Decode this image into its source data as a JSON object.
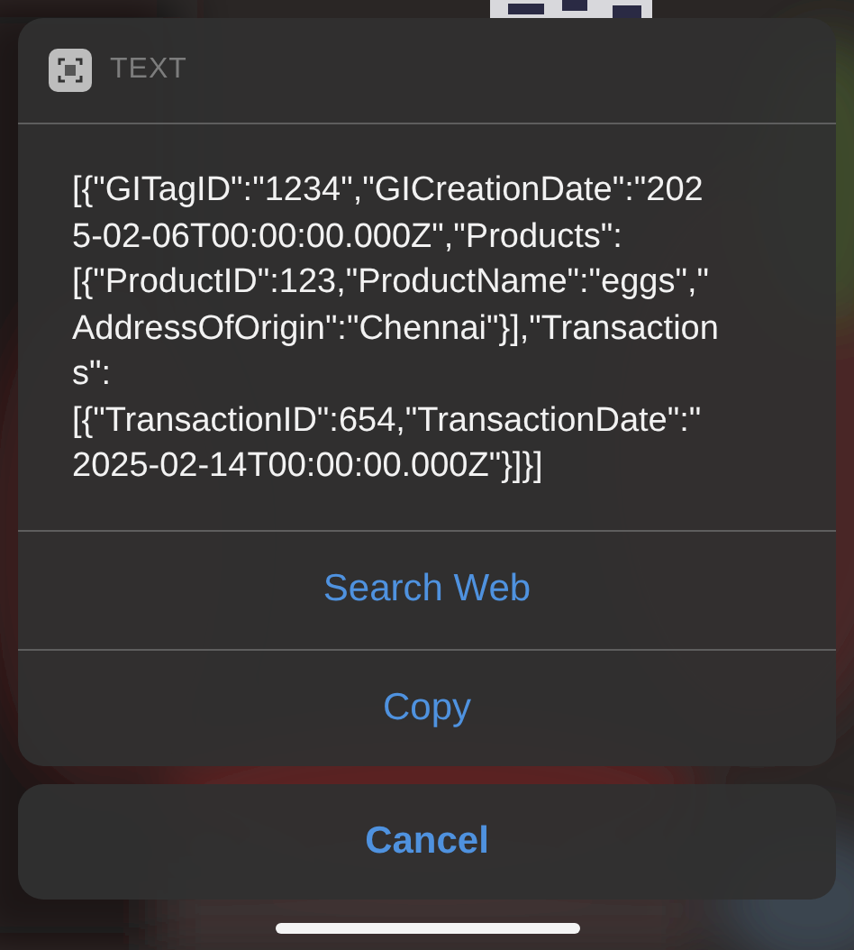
{
  "sheet": {
    "header": {
      "label": "TEXT"
    },
    "content_lines": [
      "[{\"GITagID\":\"1234\",\"GICreationDate\":\"202",
      "5-02-06T00:00:00.000Z\",\"Products\":",
      "[{\"ProductID\":123,\"ProductName\":\"eggs\",\"",
      "AddressOfOrigin\":\"Chennai\"}],\"Transaction",
      "s\":",
      "[{\"TransactionID\":654,\"TransactionDate\":\"",
      "2025-02-14T00:00:00.000Z\"}]}]"
    ],
    "actions": [
      {
        "label": "Search Web"
      },
      {
        "label": "Copy"
      }
    ]
  },
  "cancel": {
    "label": "Cancel"
  }
}
